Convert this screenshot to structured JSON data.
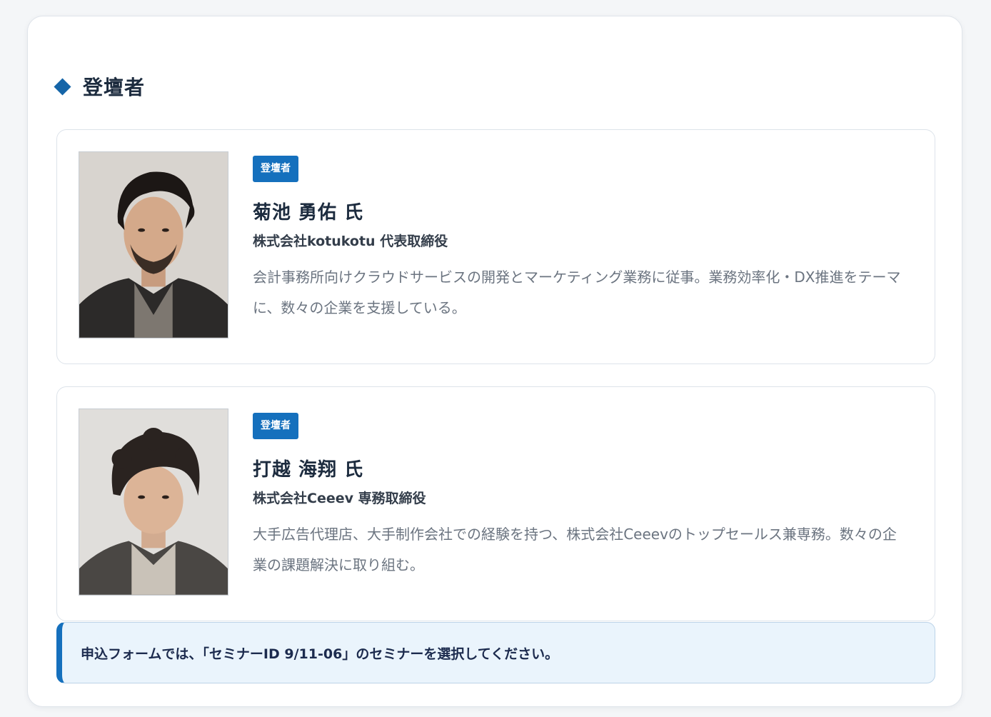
{
  "section": {
    "title": "登壇者"
  },
  "speakers": [
    {
      "badge": "登壇者",
      "name": "菊池 勇佑 氏",
      "title": "株式会社kotukotu 代表取締役",
      "description": "会計事務所向けクラウドサービスの開発とマーケティング業務に従事。業務効率化・DX推進をテーマに、数々の企業を支援している。"
    },
    {
      "badge": "登壇者",
      "name": "打越 海翔 氏",
      "title": "株式会社Ceeev 専務取締役",
      "description": "大手広告代理店、大手制作会社での経験を持つ、株式会社Ceeevのトップセールス兼専務。数々の企業の課題解決に取り組む。"
    }
  ],
  "notice": {
    "text": "申込フォームでは、「セミナーID 9/11-06」のセミナーを選択してください。"
  },
  "colors": {
    "accent": "#1570bd",
    "heading": "#1c2b3e",
    "notice_bg": "#eaf4fc"
  }
}
